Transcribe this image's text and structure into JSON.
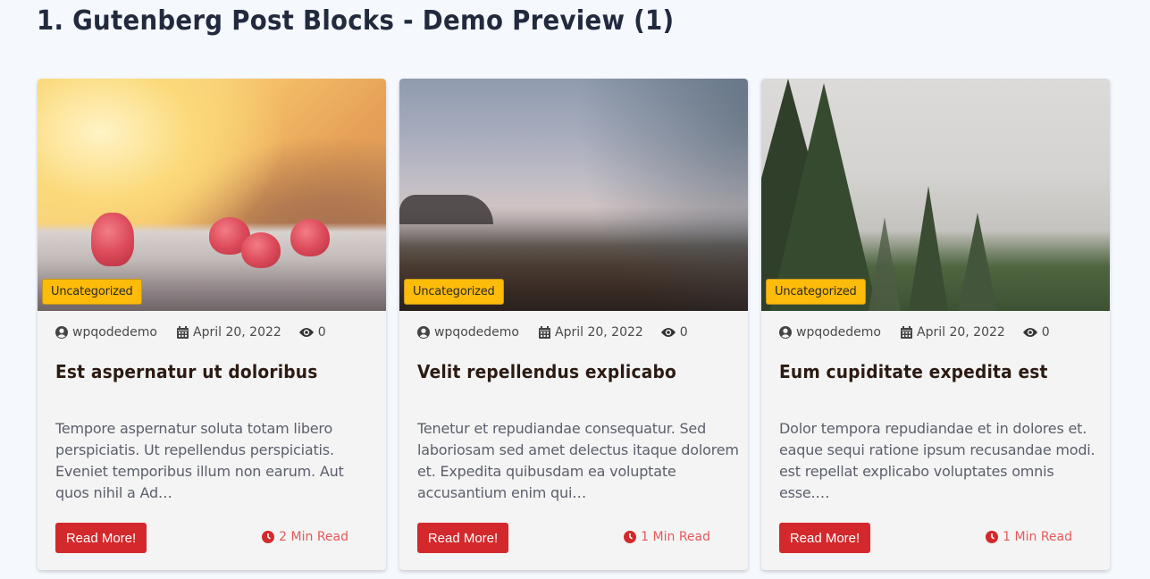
{
  "page": {
    "title": "1. Gutenberg Post Blocks - Demo Preview (1)"
  },
  "colors": {
    "background": "#f5f9fe",
    "badge": "#fdbb0a",
    "button": "#d3292c",
    "read_time": "#e45a5c",
    "title_text": "#222a3e"
  },
  "posts": [
    {
      "image": "raspberries-on-railing",
      "category": "Uncategorized",
      "author": "wpqodedemo",
      "date": "April 20, 2022",
      "views": "0",
      "title": "Est aspernatur ut doloribus",
      "excerpt": "Tempore aspernatur soluta totam libero perspiciatis. Ut repellendus perspiciatis. Eveniet temporibus illum non earum. Aut quos nihil a Ad…",
      "button_label": "Read More!",
      "read_time": "2 Min Read"
    },
    {
      "image": "foggy-field",
      "category": "Uncategorized",
      "author": "wpqodedemo",
      "date": "April 20, 2022",
      "views": "0",
      "title": "Velit repellendus explicabo",
      "excerpt": "Tenetur et repudiandae consequatur. Sed laboriosam sed amet delectus itaque dolorem et. Expedita quibusdam ea voluptate accusantium enim qui…",
      "button_label": "Read More!",
      "read_time": "1 Min Read"
    },
    {
      "image": "misty-forest",
      "category": "Uncategorized",
      "author": "wpqodedemo",
      "date": "April 20, 2022",
      "views": "0",
      "title": "Eum cupiditate expedita est",
      "excerpt": "Dolor tempora repudiandae et in dolores et. eaque sequi ratione ipsum recusandae modi. est repellat explicabo voluptates omnis esse.…",
      "button_label": "Read More!",
      "read_time": "1 Min Read"
    }
  ],
  "icons": {
    "author": "user-circle-icon",
    "date": "calendar-icon",
    "views": "eye-icon",
    "read_time": "clock-icon"
  }
}
